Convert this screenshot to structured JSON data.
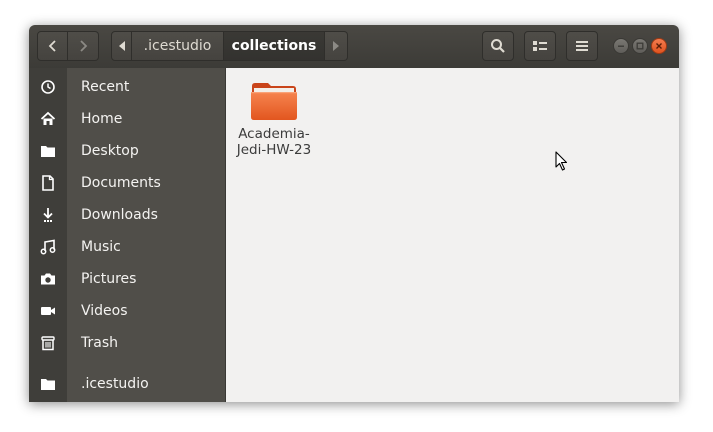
{
  "header": {
    "breadcrumbs": [
      {
        "label": ".icestudio"
      },
      {
        "label": "collections"
      }
    ]
  },
  "sidebar": {
    "items": [
      {
        "label": "Recent",
        "icon": "clock-icon"
      },
      {
        "label": "Home",
        "icon": "home-icon"
      },
      {
        "label": "Desktop",
        "icon": "folder-icon"
      },
      {
        "label": "Documents",
        "icon": "document-icon"
      },
      {
        "label": "Downloads",
        "icon": "download-icon"
      },
      {
        "label": "Music",
        "icon": "music-icon"
      },
      {
        "label": "Pictures",
        "icon": "camera-icon"
      },
      {
        "label": "Videos",
        "icon": "video-icon"
      },
      {
        "label": "Trash",
        "icon": "trash-icon"
      },
      {
        "label": ".icestudio",
        "icon": "folder-icon"
      }
    ]
  },
  "content": {
    "items": [
      {
        "name": "Academia-Jedi-HW-23",
        "line1": "Academia-",
        "line2": "Jedi-HW-23",
        "icon": "folder-icon"
      }
    ]
  },
  "colors": {
    "accent": "#e95420",
    "sidebar_bg": "#504e49",
    "header_bg": "#3c3b37",
    "content_bg": "#f2f1f0"
  }
}
